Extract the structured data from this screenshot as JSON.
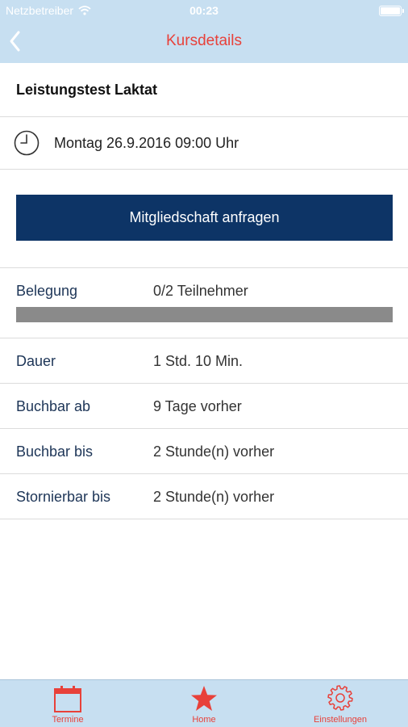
{
  "status_bar": {
    "carrier": "Netzbetreiber",
    "time": "00:23"
  },
  "nav": {
    "title": "Kursdetails",
    "back_icon": "chevron-left-icon"
  },
  "course": {
    "title": "Leistungstest Laktat",
    "datetime": "Montag 26.9.2016 09:00 Uhr",
    "datetime_icon": "clock-icon"
  },
  "cta": {
    "label": "Mitgliedschaft anfragen"
  },
  "details": {
    "occupancy_label": "Belegung",
    "occupancy_value": "0/2 Teilnehmer",
    "occupancy_fraction": 0,
    "rows": [
      {
        "label": "Dauer",
        "value": "1 Std. 10 Min."
      },
      {
        "label": "Buchbar ab",
        "value": "9 Tage vorher"
      },
      {
        "label": "Buchbar bis",
        "value": "2 Stunde(n) vorher"
      },
      {
        "label": "Stornierbar bis",
        "value": "2 Stunde(n) vorher"
      }
    ]
  },
  "tabbar": {
    "tabs": [
      {
        "label": "Termine",
        "icon": "calendar-icon"
      },
      {
        "label": "Home",
        "icon": "star-icon"
      },
      {
        "label": "Einstellungen",
        "icon": "gear-icon"
      }
    ]
  },
  "colors": {
    "accent_red": "#e8413a",
    "bar_blue": "#c7dff1",
    "button_navy": "#0d3466",
    "label_navy": "#1d3557"
  }
}
